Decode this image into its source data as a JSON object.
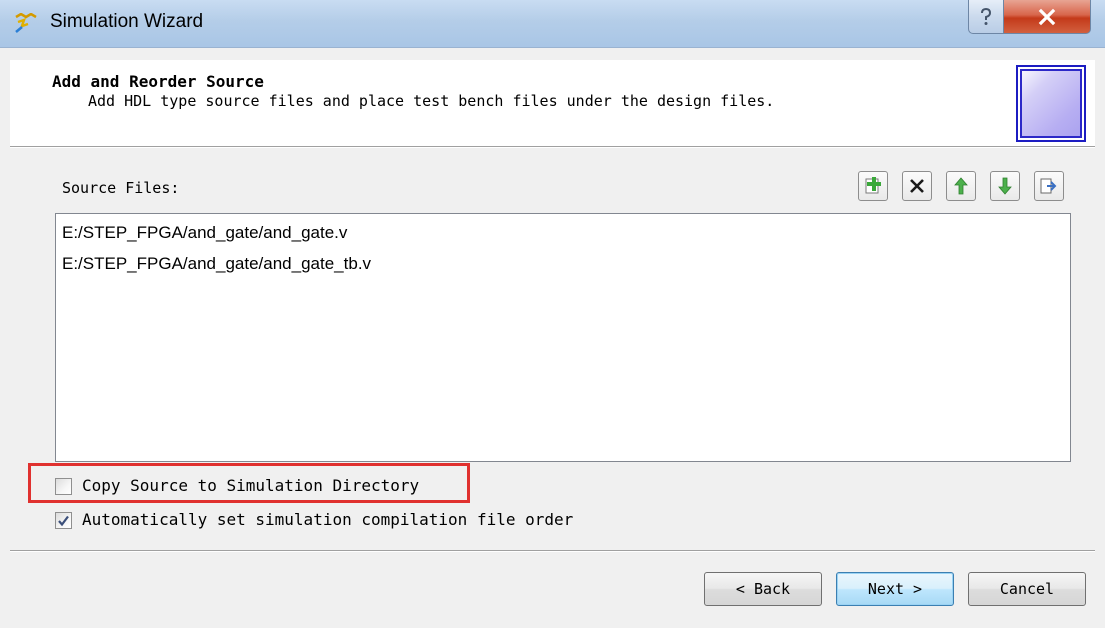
{
  "window": {
    "title": "Simulation Wizard",
    "help_icon": "question-mark-icon",
    "close_icon": "close-x-icon"
  },
  "header": {
    "title": "Add and Reorder Source",
    "subtitle": "Add HDL type source files and place test bench files under the design files."
  },
  "source": {
    "label": "Source Files:",
    "toolbar": [
      {
        "icon": "add-file-icon",
        "action": "add"
      },
      {
        "icon": "remove-icon",
        "action": "remove"
      },
      {
        "icon": "move-up-icon",
        "action": "move-up"
      },
      {
        "icon": "move-down-icon",
        "action": "move-down"
      },
      {
        "icon": "export-icon",
        "action": "export"
      }
    ],
    "files": [
      "E:/STEP_FPGA/and_gate/and_gate.v",
      "E:/STEP_FPGA/and_gate/and_gate_tb.v"
    ]
  },
  "options": {
    "copy_source": {
      "label": "Copy Source to Simulation Directory",
      "checked": false
    },
    "auto_order": {
      "label": "Automatically set simulation compilation file order",
      "checked": true
    }
  },
  "buttons": {
    "back": "< Back",
    "next": "Next >",
    "cancel": "Cancel"
  },
  "colors": {
    "highlight": "#e0312f",
    "accent_green": "#3aa83a",
    "close_red": "#c43a1a"
  }
}
